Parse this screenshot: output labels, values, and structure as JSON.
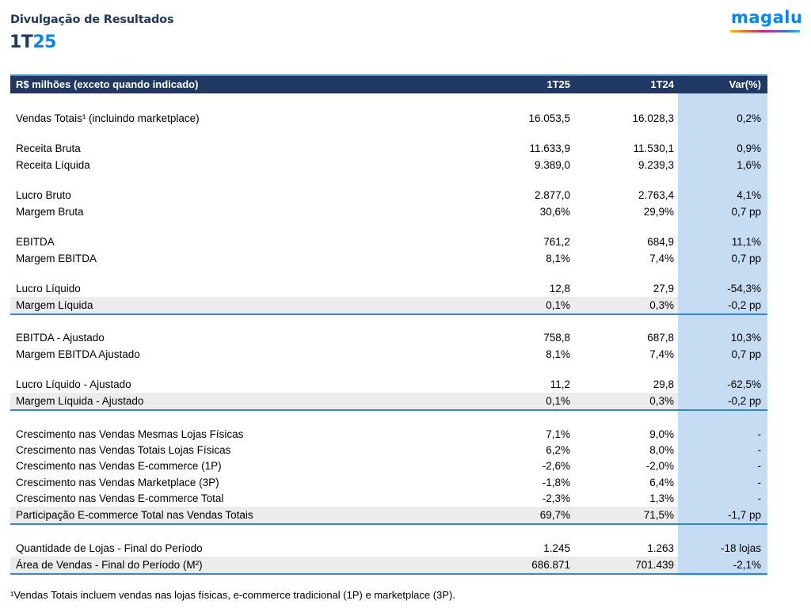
{
  "header": {
    "title": "Divulgação de Resultados",
    "period_prefix": "1T",
    "period_suffix": "25",
    "logo_text": "magalu"
  },
  "table": {
    "columns": [
      "R$ milhões (exceto quando indicado)",
      "1T25",
      "1T24",
      "Var(%)"
    ],
    "rows": [
      {
        "label": "Vendas Totais¹ (incluindo marketplace)",
        "v1": "16.053,5",
        "v2": "16.028,3",
        "var": "0,2%"
      },
      {
        "label": "Receita Bruta",
        "v1": "11.633,9",
        "v2": "11.530,1",
        "var": "0,9%"
      },
      {
        "label": "Receita Líquida",
        "v1": "9.389,0",
        "v2": "9.239,3",
        "var": "1,6%"
      },
      {
        "label": "Lucro Bruto",
        "v1": "2.877,0",
        "v2": "2.763,4",
        "var": "4,1%"
      },
      {
        "label": "Margem Bruta",
        "v1": "30,6%",
        "v2": "29,9%",
        "var": "0,7 pp"
      },
      {
        "label": "EBITDA",
        "v1": "761,2",
        "v2": "684,9",
        "var": "11,1%"
      },
      {
        "label": "Margem EBITDA",
        "v1": "8,1%",
        "v2": "7,4%",
        "var": "0,7 pp"
      },
      {
        "label": "Lucro Líquido",
        "v1": "12,8",
        "v2": "27,9",
        "var": "-54,3%"
      },
      {
        "label": "Margem Líquida",
        "v1": "0,1%",
        "v2": "0,3%",
        "var": "-0,2 pp"
      },
      {
        "label": "EBITDA - Ajustado",
        "v1": "758,8",
        "v2": "687,8",
        "var": "10,3%"
      },
      {
        "label": "Margem EBITDA Ajustado",
        "v1": "8,1%",
        "v2": "7,4%",
        "var": "0,7 pp"
      },
      {
        "label": "Lucro Líquido - Ajustado",
        "v1": "11,2",
        "v2": "29,8",
        "var": "-62,5%"
      },
      {
        "label": "Margem Líquida - Ajustado",
        "v1": "0,1%",
        "v2": "0,3%",
        "var": "-0,2 pp"
      },
      {
        "label": "Crescimento nas Vendas Mesmas Lojas Físicas",
        "v1": "7,1%",
        "v2": "9,0%",
        "var": "-"
      },
      {
        "label": "Crescimento nas Vendas Totais Lojas Físicas",
        "v1": "6,2%",
        "v2": "8,0%",
        "var": "-"
      },
      {
        "label": "Crescimento nas Vendas E-commerce (1P)",
        "v1": "-2,6%",
        "v2": "-2,0%",
        "var": "-"
      },
      {
        "label": "Crescimento nas Vendas Marketplace (3P)",
        "v1": "-1,8%",
        "v2": "6,4%",
        "var": "-"
      },
      {
        "label": "Crescimento nas Vendas E-commerce Total",
        "v1": "-2,3%",
        "v2": "1,3%",
        "var": "-"
      },
      {
        "label": "Participação E-commerce Total nas Vendas Totais",
        "v1": "69,7%",
        "v2": "71,5%",
        "var": "-1,7 pp"
      },
      {
        "label": "Quantidade de Lojas - Final do Período",
        "v1": "1.245",
        "v2": "1.263",
        "var": "-18 lojas"
      },
      {
        "label": "Área de Vendas - Final do Período (M²)",
        "v1": "686.871",
        "v2": "701.439",
        "var": "-2,1%"
      }
    ]
  },
  "footnote": "¹Vendas Totais incluem vendas nas lojas físicas, e-commerce tradicional (1P) e marketplace (3P).",
  "colors": {
    "header_navy": "#1f3864",
    "accent_blue": "#0086ff",
    "rule_blue": "#2e86d6",
    "var_column_bg": "#c5dcf2",
    "row_shade": "#ececec"
  }
}
